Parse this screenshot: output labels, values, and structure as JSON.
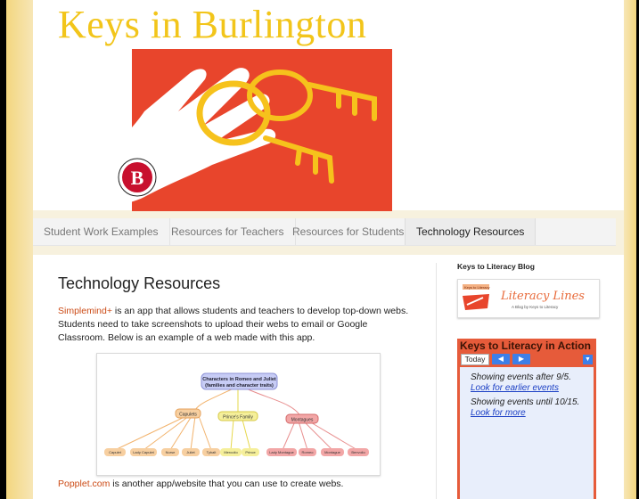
{
  "blog": {
    "title": "Keys in Burlington"
  },
  "nav": {
    "tabs": [
      {
        "label": "Student Work Examples"
      },
      {
        "label": "Resources for Teachers"
      },
      {
        "label": "Resources for Students"
      },
      {
        "label": "Technology Resources",
        "active": true
      }
    ]
  },
  "post": {
    "title": "Technology Resources",
    "intro_link": "Simplemind+",
    "intro_text": " is an app that allows students and teachers to develop top-down webs. Students need to take screenshots to upload their webs to email or Google Classroom. Below is an example of a web made with this app.",
    "second_link": "Popplet.com",
    "second_text": " is another app/website that you can use to create webs."
  },
  "mindmap": {
    "root_line1": "Characters in Romeo and Juliet",
    "root_line2": "(families and character traits)",
    "branches": [
      "Capulets",
      "Prince's Family",
      "Montagues"
    ],
    "leaves": [
      "Capulet",
      "Lady Capulet",
      "Nurse",
      "Juliet",
      "Tybalt",
      "Mercutio",
      "Prince",
      "Lady Montague",
      "Romeo",
      "Montague",
      "Benvolio"
    ],
    "colors": {
      "root": "#c7ccf5",
      "capulet": "#f7cfa0",
      "prince": "#f5ef9a",
      "montague": "#f2a6a6"
    }
  },
  "sidebar": {
    "blog_heading": "Keys to Literacy Blog",
    "widget_small": "Keys to Literacy",
    "widget_title": "Literacy Lines",
    "widget_sub": "A Blog by Keys to Literacy",
    "calendar": {
      "title": "Keys to Literacy in Action",
      "today_label": "Today",
      "entry1_text": "Showing events after 9/5.",
      "entry1_link": "Look for earlier events",
      "entry2_text": "Showing events until 10/15.",
      "entry2_link": "Look for more"
    }
  },
  "colors": {
    "title_gold": "#f2c51a",
    "link_orange": "#cc4b16",
    "banner_red": "#e8452c",
    "calendar_red": "#e65b3a",
    "calendar_blue": "#3d7fe8"
  }
}
